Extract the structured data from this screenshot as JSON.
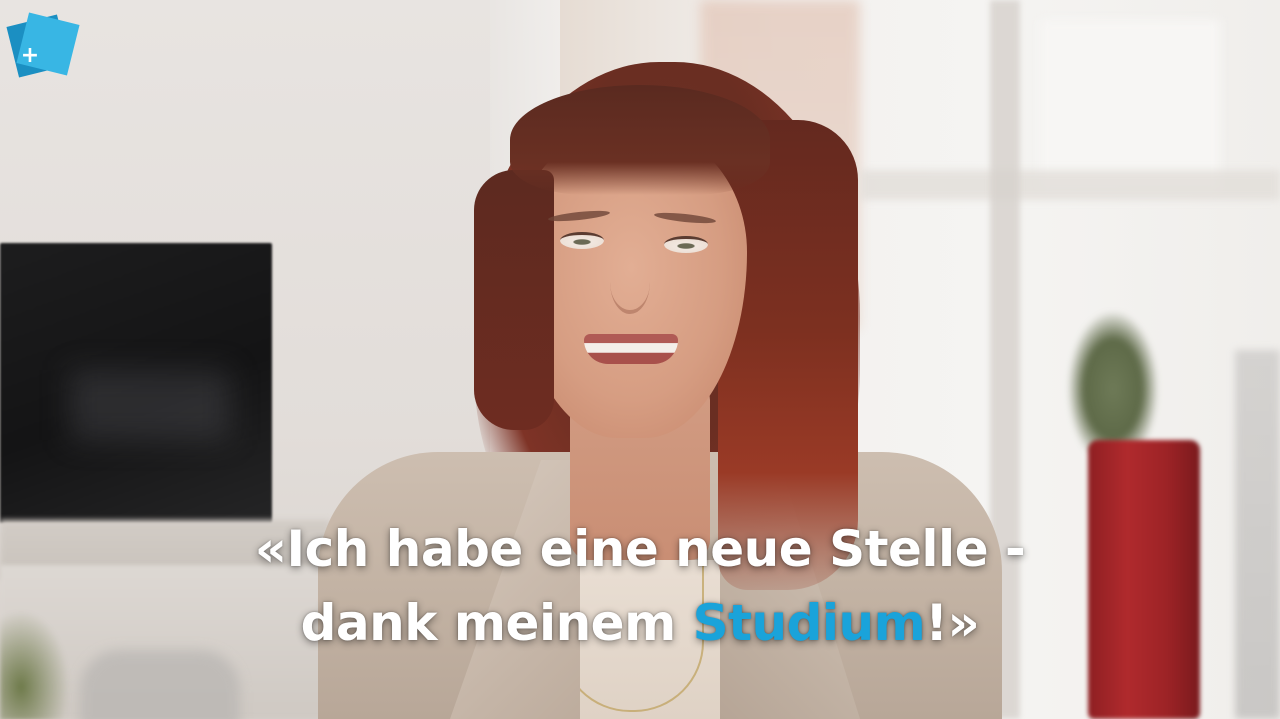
{
  "logo": {
    "icon": "plus-icon",
    "symbol": "+",
    "colors": {
      "back": "#1b8fc2",
      "front": "#38b6e4",
      "plus": "#ffffff"
    }
  },
  "subtitle": {
    "line1": "«Ich habe eine neue Stelle -",
    "line2_prefix": "dank meinem ",
    "line2_highlight": "Studium",
    "line2_suffix": "!»",
    "color": "#ffffff",
    "highlight_color": "#1aa3da"
  }
}
